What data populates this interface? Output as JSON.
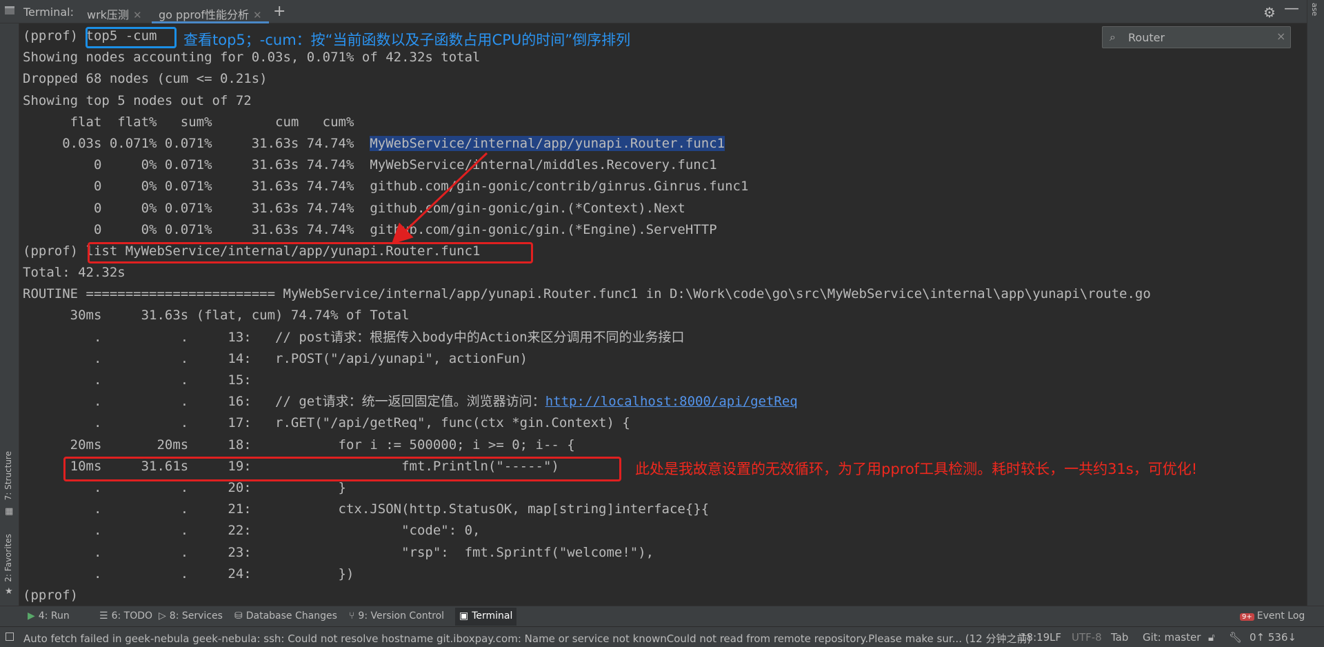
{
  "topbar": {
    "label": "Terminal:",
    "tabs": [
      {
        "label": "wrk压测"
      },
      {
        "label": "go pprof性能分析"
      }
    ],
    "add": "+",
    "settings_icon": "gear-icon",
    "minimize": "—",
    "right_strip": "ase"
  },
  "search": {
    "value": "Router",
    "search_icon": "search-icon",
    "clear": "×"
  },
  "terminal": {
    "lines": [
      "(pprof) top5 -cum",
      "Showing nodes accounting for 0.03s, 0.071% of 42.32s total",
      "Dropped 68 nodes (cum <= 0.21s)",
      "Showing top 5 nodes out of 72",
      "      flat  flat%   sum%        cum   cum%",
      "     0.03s 0.071% 0.071%     31.63s 74.74%  ",
      "         0     0% 0.071%     31.63s 74.74%  MyWebService/internal/middles.Recovery.func1",
      "         0     0% 0.071%     31.63s 74.74%  github.com/gin-gonic/contrib/ginrus.Ginrus.func1",
      "         0     0% 0.071%     31.63s 74.74%  github.com/gin-gonic/gin.(*Context).Next",
      "         0     0% 0.071%     31.63s 74.74%  github.com/gin-gonic/gin.(*Engine).ServeHTTP",
      "(pprof) list MyWebService/internal/app/yunapi.Router.func1",
      "Total: 42.32s",
      "ROUTINE ======================== MyWebService/internal/app/yunapi.Router.func1 in D:\\Work\\code\\go\\src\\MyWebService\\internal\\app\\yunapi\\route.go",
      "      30ms     31.63s (flat, cum) 74.74% of Total",
      "         .          .     13:   // post请求：根据传入body中的Action来区分调用不同的业务接口",
      "         .          .     14:   r.POST(\"/api/yunapi\", actionFun)",
      "         .          .     15:",
      "         .          .     16:   // get请求：统一返回固定值。浏览器访问：",
      "         .          .     17:   r.GET(\"/api/getReq\", func(ctx *gin.Context) {",
      "      20ms       20ms     18:           for i := 500000; i >= 0; i-- {",
      "      10ms     31.61s     19:                   fmt.Println(\"-----\")",
      "         .          .     20:           }",
      "         .          .     21:           ctx.JSON(http.StatusOK, map[string]interface{}{",
      "         .          .     22:                   \"code\": 0,",
      "         .          .     23:                   \"rsp\":  fmt.Sprintf(\"welcome!\"),",
      "         .          .     24:           })",
      "(pprof)"
    ],
    "highlight_text": "MyWebService/internal/app/yunapi.Router.func1",
    "link_text": "http://localhost:8000/api/getReq"
  },
  "annotations": {
    "top5": "查看top5；-cum：按“当前函数以及子函数占用CPU的时间”倒序排列",
    "loop": "此处是我故意设置的无效循环，为了用pprof工具检测。耗时较长，一共约31s，可优化!",
    "box_blue": "#1b8fe6",
    "box_red": "#e02020"
  },
  "left_strip": {
    "structure": "7: Structure",
    "favorites": "2: Favorites"
  },
  "toolwindows": [
    {
      "label": "4: Run",
      "icon": "run-icon"
    },
    {
      "label": "6: TODO",
      "icon": "todo-icon"
    },
    {
      "label": "8: Services",
      "icon": "services-icon"
    },
    {
      "label": "Database Changes",
      "icon": "database-icon"
    },
    {
      "label": "9: Version Control",
      "icon": "vcs-icon"
    },
    {
      "label": "Terminal",
      "icon": "terminal-icon"
    }
  ],
  "event_log": {
    "badge": "9+",
    "label": "Event Log"
  },
  "status": {
    "message": "Auto fetch failed in geek-nebula geek-nebula: ssh: Could not resolve hostname git.iboxpay.com: Name or service not knownCould not read from remote repository.Please make sur... (12 分钟之前)",
    "position": "18:19",
    "line_sep": "LF",
    "encoding": "UTF-8",
    "indent": "Tab",
    "branch": "Git: master",
    "counter": "0↑ 536↓"
  }
}
